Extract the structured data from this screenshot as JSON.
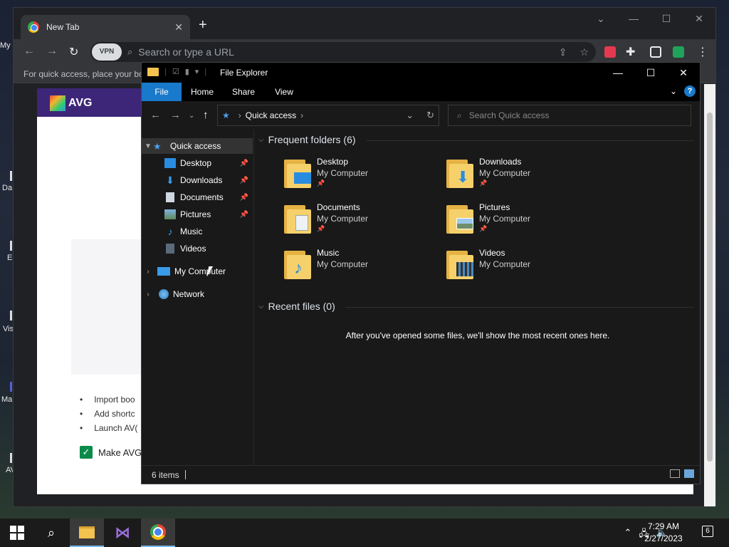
{
  "desktop": {
    "labels": [
      "My",
      "Da",
      "E",
      "Vis",
      "Ma",
      "AV"
    ]
  },
  "chrome": {
    "tab_title": "New Tab",
    "new_tab_symbol": "+",
    "omnibox": {
      "vpn_label": "VPN",
      "placeholder": "Search or type a URL"
    },
    "bookmarks_hint": "For quick access, place your boo",
    "avg_page": {
      "logo_text": "AVG",
      "list_items": [
        "Import boo",
        "Add shortc",
        "Launch AV("
      ],
      "checkbox_label": "Make AVG"
    }
  },
  "explorer": {
    "title": "File Explorer",
    "ribbon_tabs": [
      "File",
      "Home",
      "Share",
      "View"
    ],
    "address": {
      "current": "Quick access"
    },
    "search_placeholder": "Search Quick access",
    "nav": {
      "quick_access": "Quick access",
      "items": [
        {
          "label": "Desktop",
          "pinned": true
        },
        {
          "label": "Downloads",
          "pinned": true
        },
        {
          "label": "Documents",
          "pinned": true
        },
        {
          "label": "Pictures",
          "pinned": true
        },
        {
          "label": "Music",
          "pinned": false
        },
        {
          "label": "Videos",
          "pinned": false
        }
      ],
      "my_computer": "My Computer",
      "network": "Network"
    },
    "frequent_header": "Frequent folders (6)",
    "folders": [
      {
        "name": "Desktop",
        "location": "My Computer",
        "pinned": true,
        "icon": "desktop-overlay"
      },
      {
        "name": "Downloads",
        "location": "My Computer",
        "pinned": true,
        "icon": "download-arrow-overlay"
      },
      {
        "name": "Documents",
        "location": "My Computer",
        "pinned": true,
        "icon": "document-overlay"
      },
      {
        "name": "Pictures",
        "location": "My Computer",
        "pinned": true,
        "icon": "picture-overlay"
      },
      {
        "name": "Music",
        "location": "My Computer",
        "pinned": false,
        "icon": "music-note-overlay"
      },
      {
        "name": "Videos",
        "location": "My Computer",
        "pinned": false,
        "icon": "film-overlay"
      }
    ],
    "recent_header": "Recent files (0)",
    "recent_empty": "After you've opened some files, we'll show the most recent ones here.",
    "status_items": "6 items"
  },
  "taskbar": {
    "time": "7:29 AM",
    "date": "2/27/2023",
    "notification_count": "6"
  },
  "colors": {
    "accent": "#1979ca",
    "folder": "#f6d16b",
    "avg_brand": "#3d2678"
  }
}
